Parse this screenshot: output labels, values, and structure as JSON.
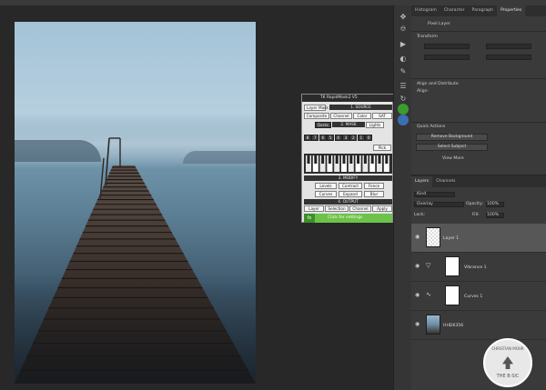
{
  "tool_icons": [
    "move-icon",
    "transform-icon",
    "play-icon",
    "adjustments-icon",
    "brush-icon",
    "layers-icon",
    "history-icon",
    "plugin-icon"
  ],
  "properties": {
    "tabs": [
      {
        "label": "Histogram"
      },
      {
        "label": "Character"
      },
      {
        "label": "Paragraph"
      },
      {
        "label": "Properties",
        "active": true
      }
    ],
    "pixel_layer_label": "Pixel Layer",
    "transform_title": "Transform",
    "align_title": "Align and Distribute",
    "align_label": "Align:",
    "quick_actions_title": "Quick Actions",
    "remove_bg_button": "Remove Background",
    "select_subject_button": "Select Subject",
    "view_more_link": "View More"
  },
  "layers_panel": {
    "tabs": [
      {
        "label": "Layers",
        "active": true
      },
      {
        "label": "Channels"
      }
    ],
    "kind_label": "Kind",
    "blend_mode": "Overlay",
    "opacity_label": "Opacity:",
    "opacity_value": "100%",
    "lock_label": "Lock:",
    "fill_label": "Fill:",
    "fill_value": "100%",
    "layers": [
      {
        "name": "Layer 1",
        "selected": true,
        "type": "pixel"
      },
      {
        "name": "Vibrance 1",
        "selected": false,
        "type": "adjustment"
      },
      {
        "name": "Curves 1",
        "selected": false,
        "type": "adjustment"
      },
      {
        "name": "HHD6356",
        "selected": false,
        "type": "photo"
      }
    ]
  },
  "plugin": {
    "title": "TK RapidMask2 V5",
    "layer_mask_label": "Layer Mask",
    "source_title": "1. SOURCE",
    "source_buttons": [
      "Composite",
      "Channel",
      "Color",
      "SAT"
    ],
    "mask_title": "2. MASK",
    "mask_buttons": [
      "Darks",
      "Lights"
    ],
    "modify_title": "3. MODIFY",
    "modify_row1": [
      "Levels",
      "Contract",
      "Fence"
    ],
    "modify_row2": [
      "Curves",
      "Expand",
      "Blur"
    ],
    "output_title": "4. OUTPUT",
    "output_buttons": [
      "Layer",
      "Selection",
      "Channel",
      "Apply"
    ],
    "click_target": "Click for settings",
    "fx_label": "fx",
    "number_row": [
      "8",
      "7",
      "6",
      "5",
      "4",
      "3",
      "2",
      "1",
      "0"
    ],
    "pick_label": "Pick"
  },
  "watermark": {
    "top": "CHRISTIAN MOHR",
    "bottom": "THE B·SIC"
  }
}
